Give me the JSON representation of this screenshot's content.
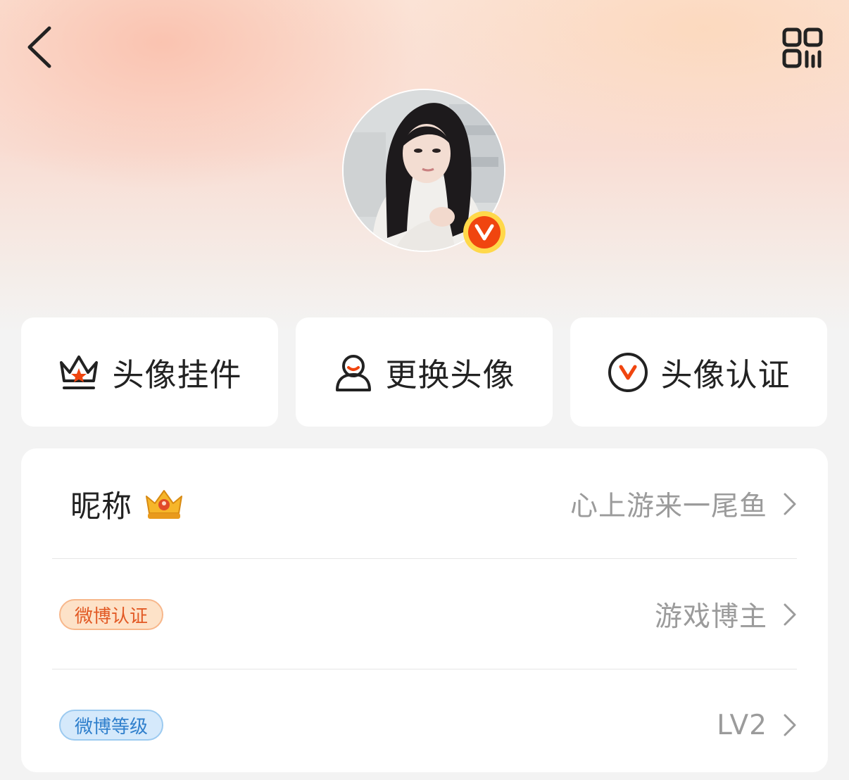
{
  "header": {
    "back_icon": "chevron-left-icon",
    "qr_icon": "qr-code-icon"
  },
  "avatar": {
    "badge_letter": "V",
    "badge_colors": {
      "outer": "#ffd84a",
      "inner": "#f0450f"
    }
  },
  "actions": [
    {
      "icon": "crown-icon",
      "label": "头像挂件"
    },
    {
      "icon": "person-icon",
      "label": "更换头像"
    },
    {
      "icon": "v-verified-icon",
      "label": "头像认证"
    }
  ],
  "profile_rows": {
    "nickname": {
      "label": "昵称",
      "icon": "gold-crown-icon",
      "value": "心上游来一尾鱼"
    },
    "verification": {
      "badge": "微博认证",
      "value": "游戏博主"
    },
    "level": {
      "badge": "微博等级",
      "value": "LV2"
    }
  },
  "colors": {
    "accent": "#f0450f",
    "value_text": "#9b9b9b",
    "primary_text": "#222222"
  }
}
